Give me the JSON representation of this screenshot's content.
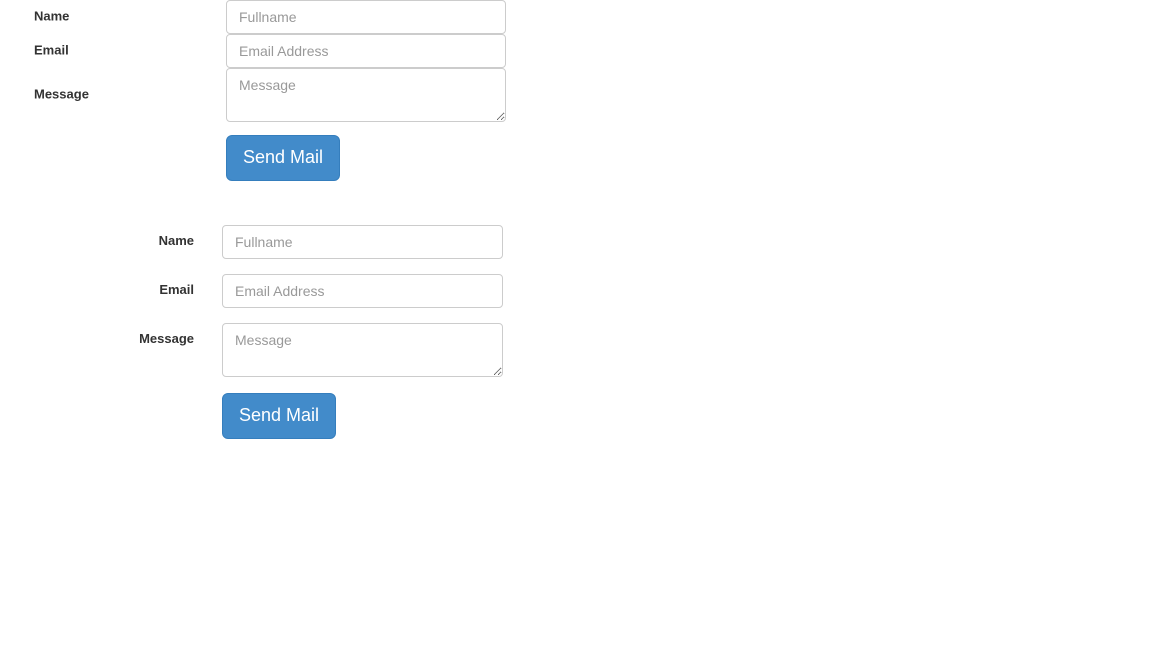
{
  "page": {
    "background_color": "#ffffff",
    "text_color": "#333333",
    "accent_color": "#428bca",
    "border_color": "#cccccc",
    "placeholder_color": "#999999"
  },
  "forms": [
    {
      "id": "contact-form-compact",
      "layout": "stacked-flush",
      "label_align": "left",
      "fields": [
        {
          "id": "name",
          "label": "Name",
          "type": "text",
          "placeholder": "Fullname",
          "value": ""
        },
        {
          "id": "email",
          "label": "Email",
          "type": "email",
          "placeholder": "Email Address",
          "value": ""
        },
        {
          "id": "message",
          "label": "Message",
          "type": "textarea",
          "placeholder": "Message",
          "value": ""
        }
      ],
      "submit": {
        "label": "Send Mail",
        "style": "primary"
      }
    },
    {
      "id": "contact-form-horizontal",
      "layout": "horizontal-spaced",
      "label_align": "right",
      "fields": [
        {
          "id": "name",
          "label": "Name",
          "type": "text",
          "placeholder": "Fullname",
          "value": ""
        },
        {
          "id": "email",
          "label": "Email",
          "type": "email",
          "placeholder": "Email Address",
          "value": ""
        },
        {
          "id": "message",
          "label": "Message",
          "type": "textarea",
          "placeholder": "Message",
          "value": ""
        }
      ],
      "submit": {
        "label": "Send Mail",
        "style": "primary"
      }
    }
  ]
}
